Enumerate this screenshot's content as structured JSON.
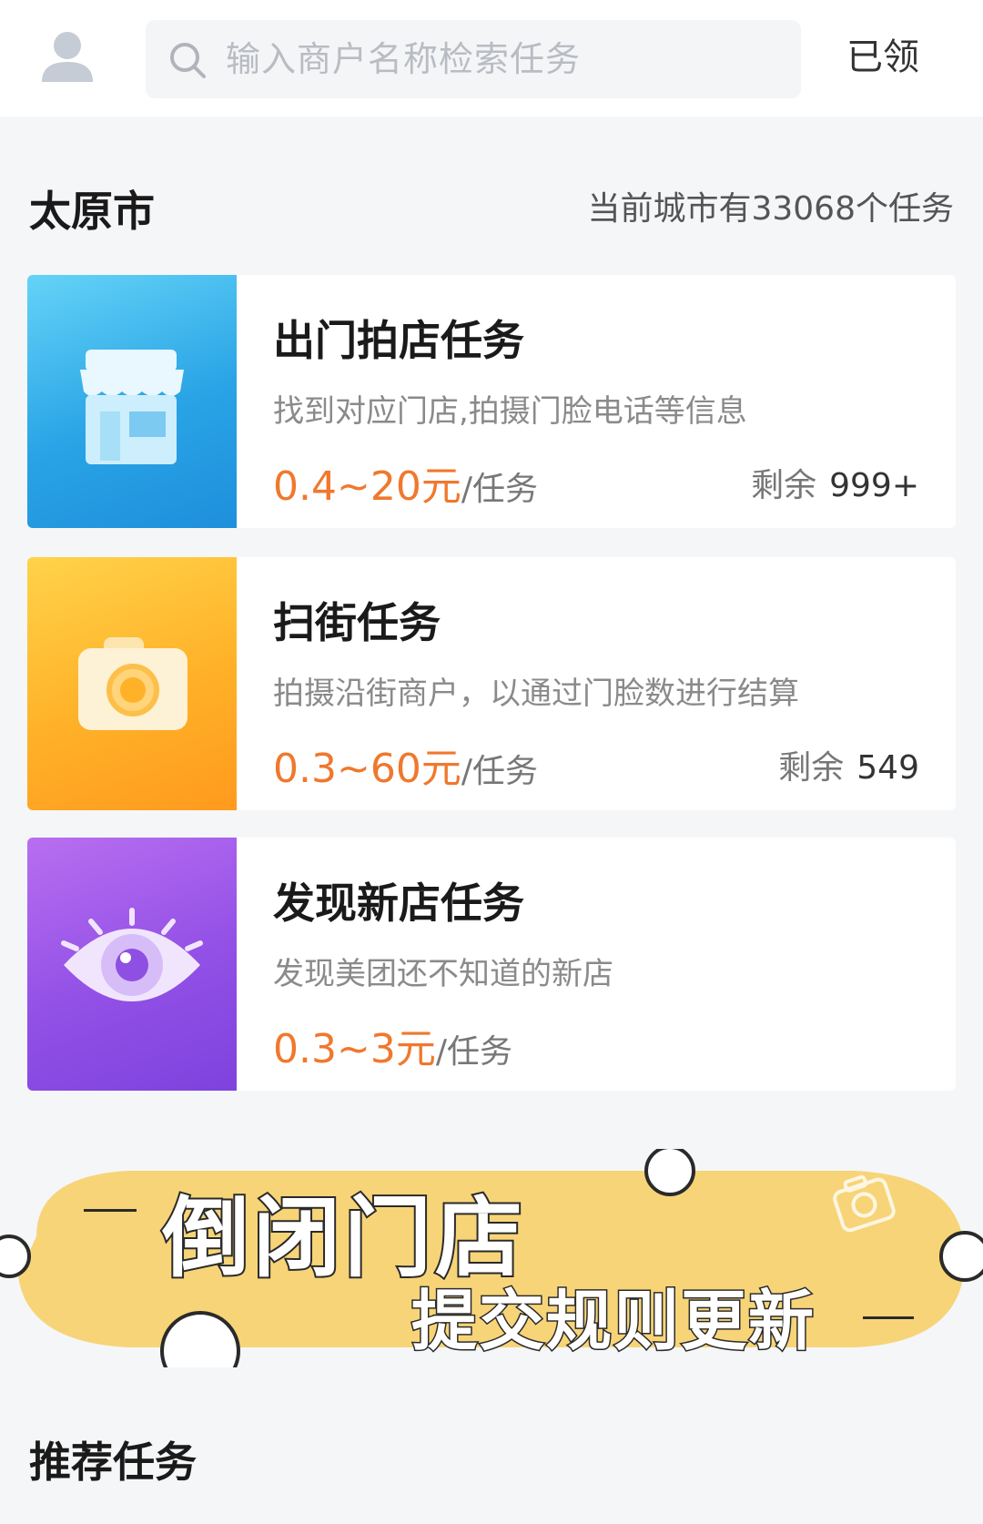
{
  "header": {
    "search_placeholder": "输入商户名称检索任务",
    "claimed_label": "已领"
  },
  "city": {
    "name": "太原市",
    "task_count_text": "当前城市有33068个任务"
  },
  "tasks": [
    {
      "title": "出门拍店任务",
      "description": "找到对应门店,拍摄门脸电话等信息",
      "price": "0.4~20元",
      "unit": "/任务",
      "remaining_label": "剩余",
      "remaining_value": "999+",
      "icon": "storefront-icon",
      "color": "#2aa4e6"
    },
    {
      "title": "扫街任务",
      "description": "拍摄沿街商户，以通过门脸数进行结算",
      "price": "0.3~60元",
      "unit": "/任务",
      "remaining_label": "剩余",
      "remaining_value": "549",
      "icon": "camera-icon",
      "color": "#ffb128"
    },
    {
      "title": "发现新店任务",
      "description": "发现美团还不知道的新店",
      "price": "0.3~3元",
      "unit": "/任务",
      "icon": "eye-icon",
      "color": "#9250e6"
    }
  ],
  "banner": {
    "title": "倒闭门店",
    "subtitle": "提交规则更新",
    "color": "#f7d477"
  },
  "recommend": {
    "heading": "推荐任务"
  },
  "colors": {
    "price": "#f0782d",
    "background": "#f5f6f8"
  }
}
